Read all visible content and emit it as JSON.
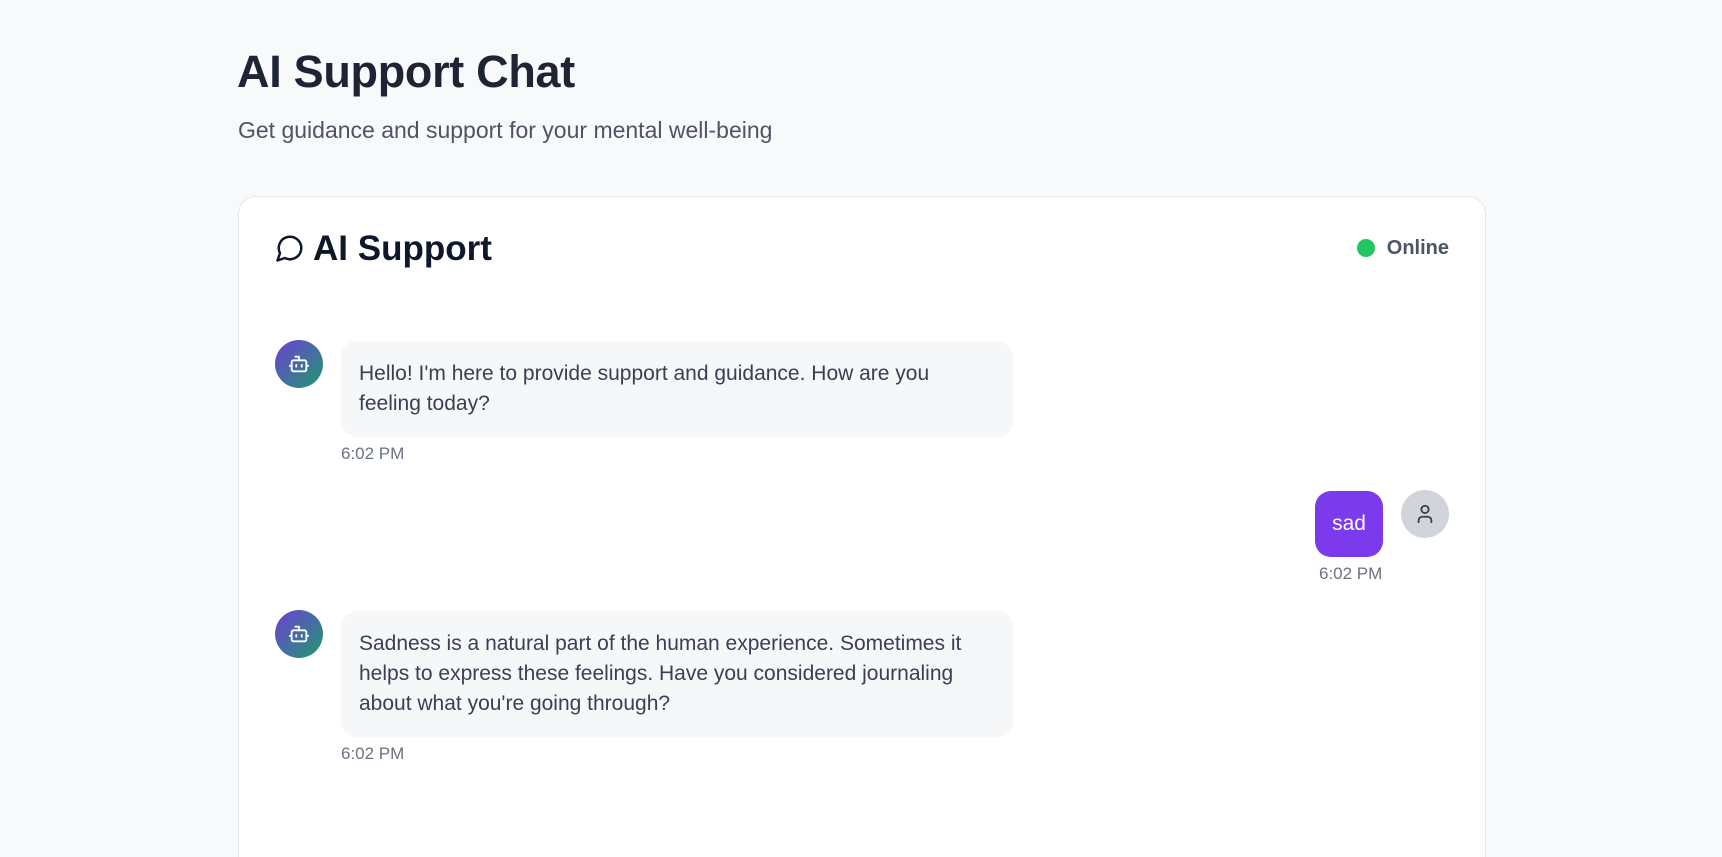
{
  "page": {
    "title": "AI Support Chat",
    "subtitle": "Get guidance and support for your mental well-being"
  },
  "chat": {
    "title": "AI Support",
    "status": "Online",
    "icon": "message-circle-icon",
    "status_color": "#22c55e",
    "messages": [
      {
        "sender": "bot",
        "text": "Hello! I'm here to provide support and guidance. How are you feeling today?",
        "time": "6:02 PM"
      },
      {
        "sender": "user",
        "text": "sad",
        "time": "6:02 PM"
      },
      {
        "sender": "bot",
        "text": "Sadness is a natural part of the human experience. Sometimes it helps to express these feelings. Have you considered journaling about what you're going through?",
        "time": "6:02 PM"
      }
    ]
  },
  "colors": {
    "accent": "#7c3aed",
    "bot_avatar_gradient_start": "#6d3fd6",
    "bot_avatar_gradient_end": "#1f9a6e",
    "user_avatar": "#d1d5db"
  }
}
